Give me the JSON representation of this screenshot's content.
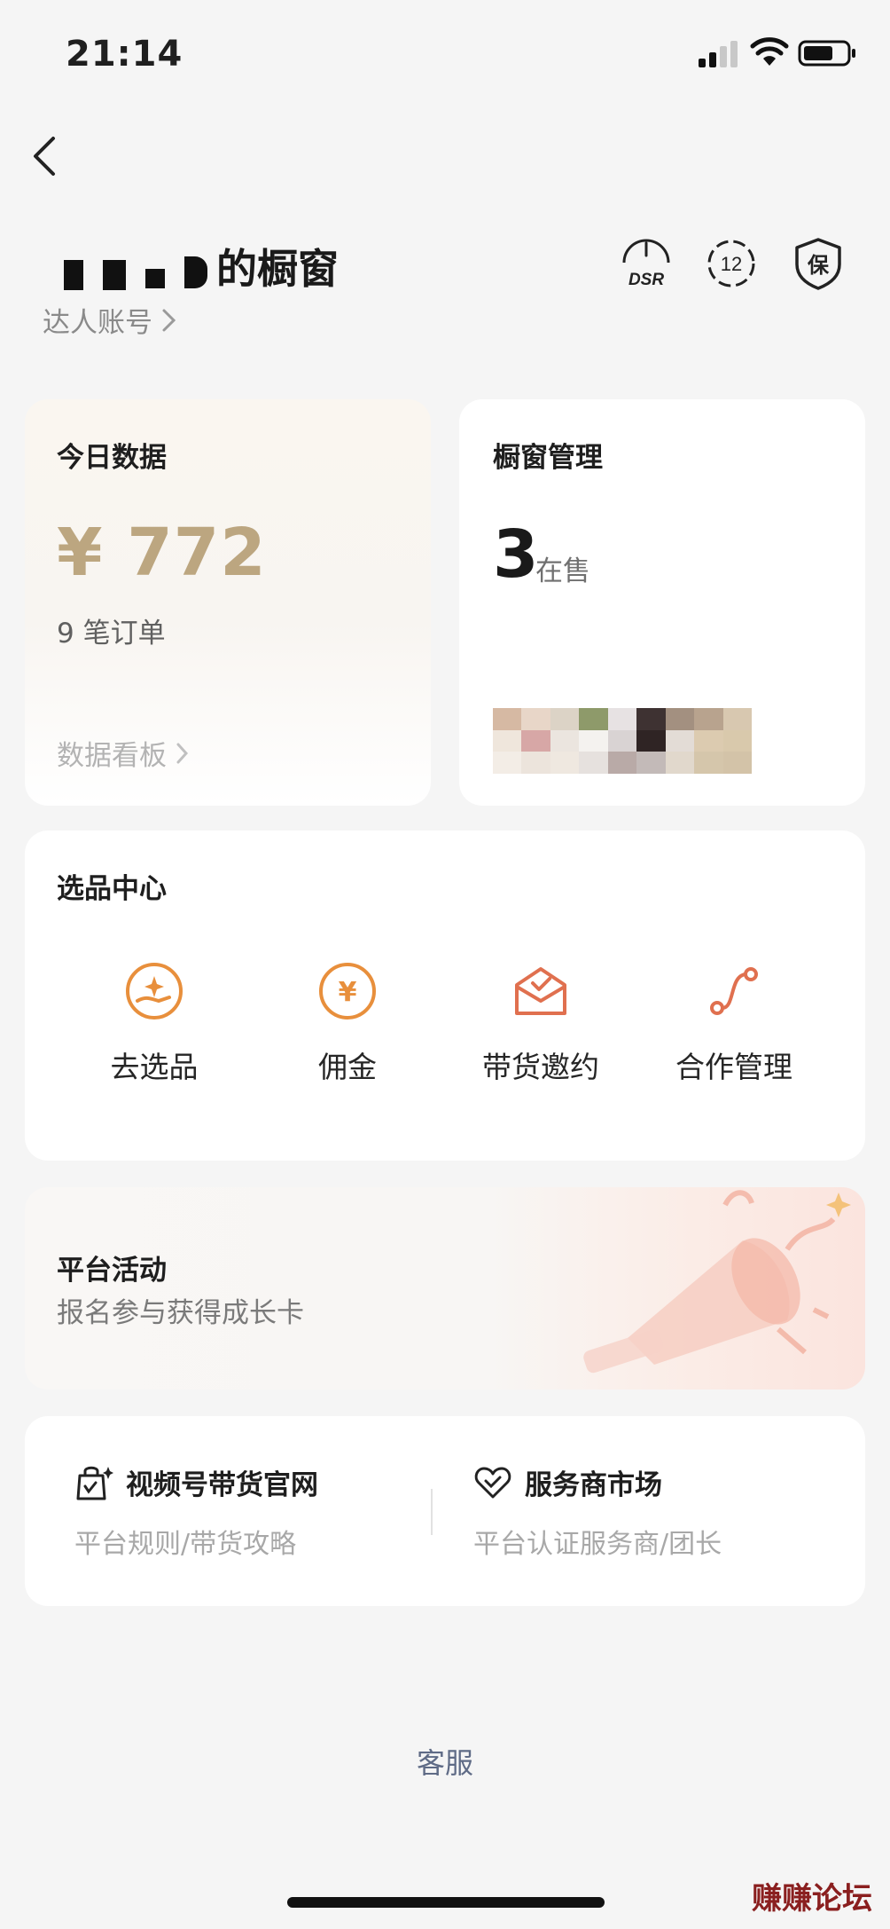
{
  "status_bar": {
    "time": "21:14"
  },
  "header": {
    "title_suffix": "的橱窗",
    "account_link": "达人账号"
  },
  "header_icons": {
    "dsr": "DSR",
    "badge_number": "12",
    "guarantee": "保"
  },
  "today_data": {
    "title": "今日数据",
    "amount": "¥ 772",
    "orders": "9 笔订单",
    "dashboard_link": "数据看板"
  },
  "window_mgmt": {
    "title": "橱窗管理",
    "count": "3",
    "count_label": "在售"
  },
  "selection_center": {
    "title": "选品中心",
    "items": [
      {
        "label": "去选品",
        "icon": "hand-sparkle-icon"
      },
      {
        "label": "佣金",
        "icon": "yuan-coin-icon"
      },
      {
        "label": "带货邀约",
        "icon": "envelope-check-icon"
      },
      {
        "label": "合作管理",
        "icon": "route-icon"
      }
    ]
  },
  "platform_activity": {
    "title": "平台活动",
    "subtitle": "报名参与获得成长卡"
  },
  "links": [
    {
      "title": "视频号带货官网",
      "subtitle": "平台规则/带货攻略",
      "icon": "shopping-bag-icon"
    },
    {
      "title": "服务商市场",
      "subtitle": "平台认证服务商/团长",
      "icon": "heart-handshake-icon"
    }
  ],
  "footer": {
    "service": "客服",
    "watermark": "赚赚论坛"
  },
  "colors": {
    "gold": "#bca680",
    "accent_orange": "#e88f3c",
    "accent_red": "#e0704f",
    "link_blue": "#5f6b86"
  }
}
